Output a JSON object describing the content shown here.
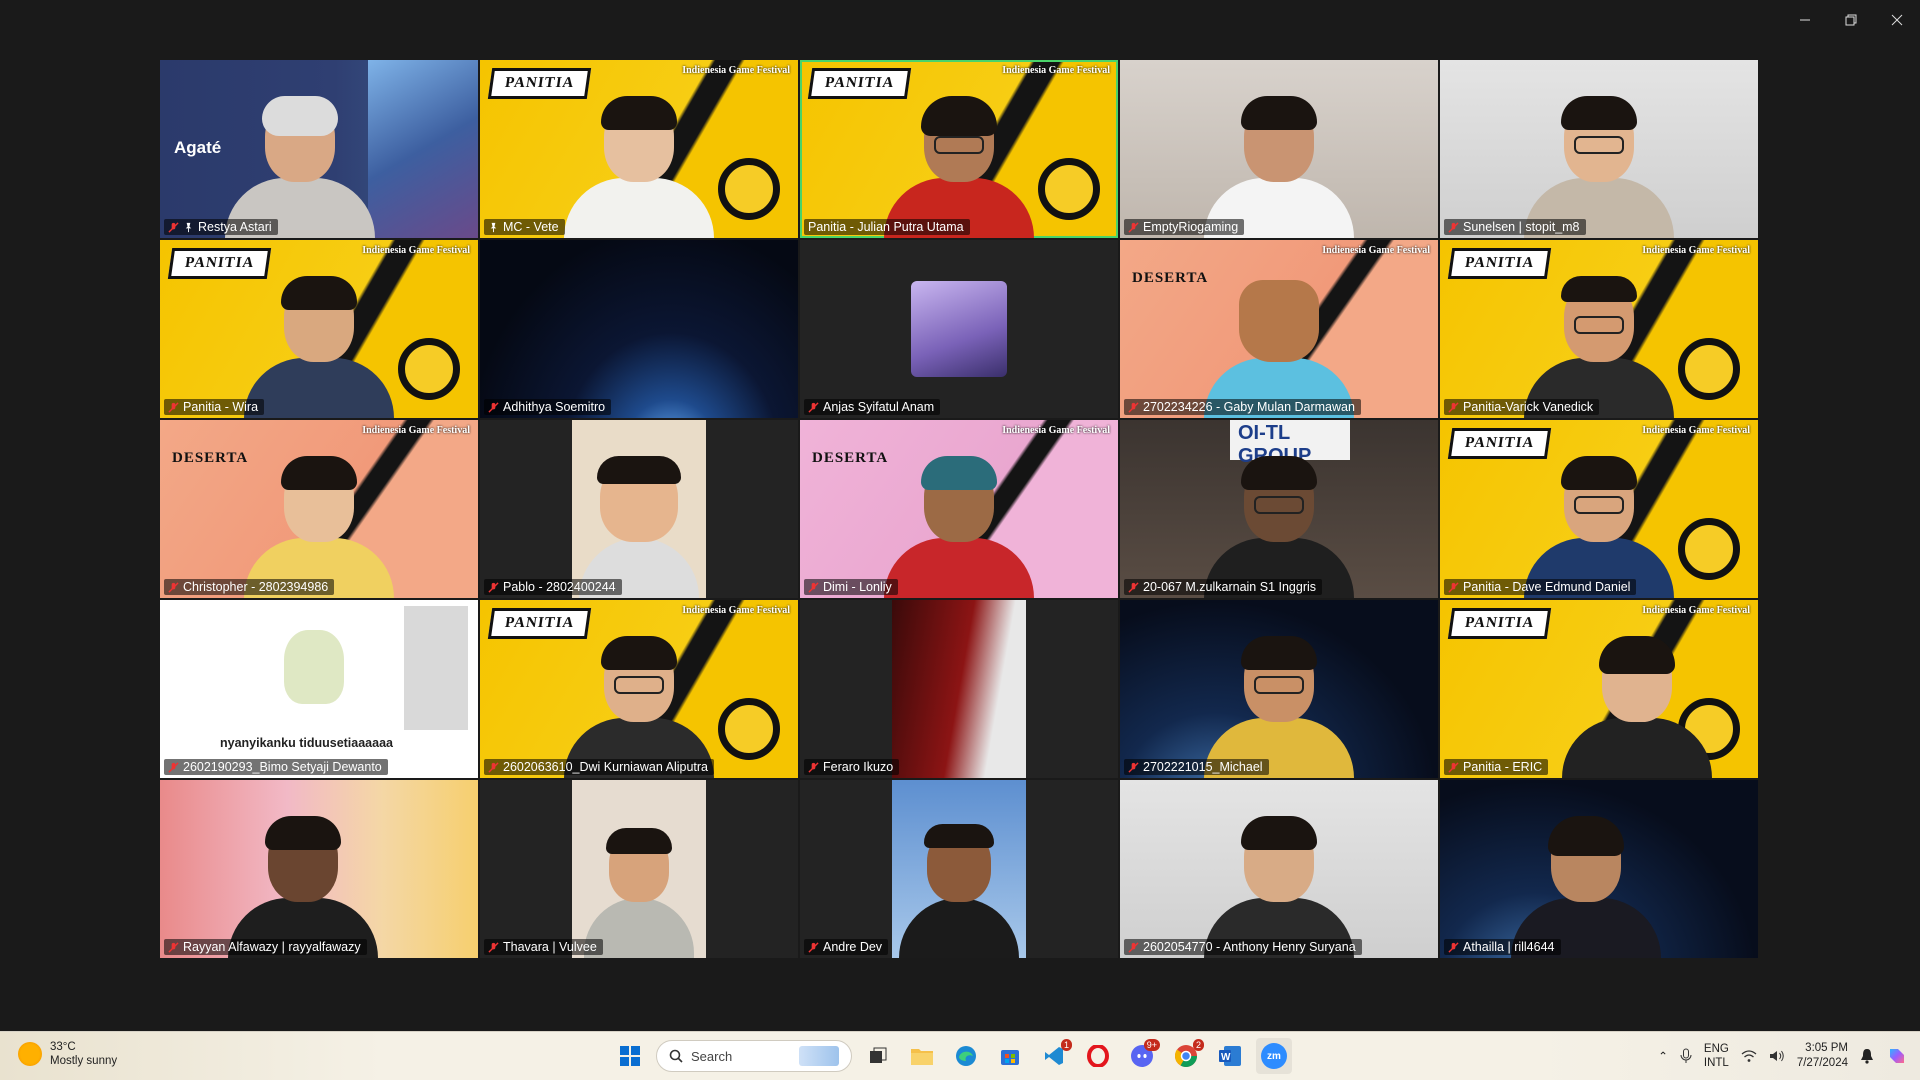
{
  "window": {
    "minimize": "—",
    "restore": "❐",
    "close": "✕"
  },
  "participants": [
    {
      "name": "Restya Astari",
      "pinned": true
    },
    {
      "name": "MC - Vete",
      "pinned": true
    },
    {
      "name": "Panitia - Julian Putra Utama",
      "active": true
    },
    {
      "name": "EmptyRiogaming"
    },
    {
      "name": "Sunelsen | stopit_m8"
    },
    {
      "name": "Panitia - Wira"
    },
    {
      "name": "Adhithya Soemitro"
    },
    {
      "name": "Anjas Syifatul Anam"
    },
    {
      "name": "2702234226 - Gaby Mulan Darmawan"
    },
    {
      "name": "Panitia-Varick Vanedick"
    },
    {
      "name": "Christopher - 2802394986"
    },
    {
      "name": "Pablo - 2802400244"
    },
    {
      "name": "Dimi - Lonliy"
    },
    {
      "name": "20-067 M.zulkarnain S1 Inggris"
    },
    {
      "name": "Panitia - Dave Edmund Daniel"
    },
    {
      "name": "2602190293_Bimo Setyaji Dewanto"
    },
    {
      "name": "2602063610_Dwi Kurniawan Aliputra"
    },
    {
      "name": "Feraro Ikuzo"
    },
    {
      "name": "2702221015_Michael"
    },
    {
      "name": "Panitia - ERIC"
    },
    {
      "name": "Rayyan Alfawazy | rayyalfawazy"
    },
    {
      "name": "Thavara | Vulvee"
    },
    {
      "name": "Andre Dev"
    },
    {
      "name": "2602054770 - Anthony Henry Suryana"
    },
    {
      "name": "Athailla | rill4644"
    }
  ],
  "overlays": {
    "panitia": "PANITIA",
    "peserta": "DESERTA",
    "festival": "Indienesia Game Festival",
    "agate": "Agaté",
    "bimo_caption": "nyanyikanku tiduusetiaaaaaa",
    "office_sign": "OI-TL GROUP"
  },
  "taskbar": {
    "weather_temp": "33°C",
    "weather_desc": "Mostly sunny",
    "search_placeholder": "Search",
    "store_badge": "",
    "vscode_badge": "1",
    "discord_badge": "9+",
    "chrome_badge": "2",
    "lang_1": "ENG",
    "lang_2": "INTL",
    "time": "3:05 PM",
    "date": "7/27/2024",
    "zoom_label": "zm"
  }
}
